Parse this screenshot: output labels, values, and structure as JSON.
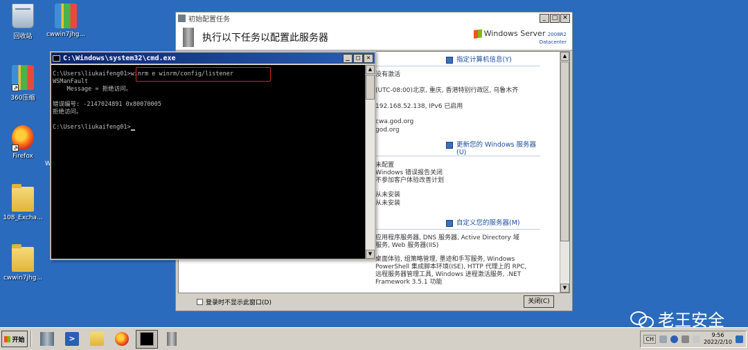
{
  "desktop": {
    "icons": [
      {
        "label": "回收站",
        "icon": "recycle-bin-icon"
      },
      {
        "label": "cwwin7jhg...",
        "icon": "archive-icon"
      },
      {
        "label": "360压缩",
        "icon": "archive-icon"
      },
      {
        "label": "Firefox",
        "icon": "firefox-icon"
      },
      {
        "label": "108_Excha...",
        "icon": "folder-icon"
      },
      {
        "label": "cwwin7jhg...",
        "icon": "folder-icon"
      }
    ],
    "partial_letter": "W"
  },
  "server_window": {
    "title": "初始配置任务",
    "heading": "执行以下任务以配置此服务器",
    "brand": "Windows Server",
    "brand_version": "2008",
    "brand_r2": "R2",
    "brand_edition": "Datacenter",
    "sections": [
      {
        "title": "指定计算机信息(Y)"
      },
      {
        "title": "更新您的 Windows 服务器",
        "subtitle": "(U)"
      },
      {
        "title": "自定义您的服务器(M)"
      }
    ],
    "lines": [
      "没有激活",
      "(UTC-08:00)北京, 重庆, 香港特别行政区, 乌鲁木齐",
      "192.168.52.138, IPv6 已启用",
      "cwa.god.org",
      "god.org",
      "未配置",
      "Windows 错误报告关闭",
      "不参加客户体验改善计划",
      "从未安装",
      "从未安装",
      "应用程序服务器, DNS 服务器, Active Directory 域",
      "服务, Web 服务器(IIS)",
      "桌面体验, 组策略管理, 墨迹和手写服务, Windows",
      "PowerShell 集成脚本环境(ISE), HTTP 代理上的 RPC,",
      "远程服务器管理工具, Windows 进程激活服务, .NET",
      "Framework 3.5.1 功能"
    ],
    "footer_checkbox": "登录时不显示此窗口(D)",
    "close_button": "关闭(C)"
  },
  "cmd_window": {
    "title": "C:\\Windows\\system32\\cmd.exe",
    "lines": [
      "C:\\Users\\liukaifeng01>winrm e winrm/config/listener",
      "WSManFault",
      "    Message = 拒绝访问。",
      "",
      "错误编号: -2147024891 0x80070005",
      "拒绝访问。",
      "",
      "C:\\Users\\liukaifeng01>"
    ]
  },
  "taskbar": {
    "start_label": "开始",
    "language": "CH",
    "time": "9:56",
    "date": "2022/2/10"
  },
  "watermark": "老王安全",
  "colors": {
    "desktop": "#2a6bbd",
    "highlight_box": "#e0201a",
    "cmd_title": "#0a246a"
  }
}
